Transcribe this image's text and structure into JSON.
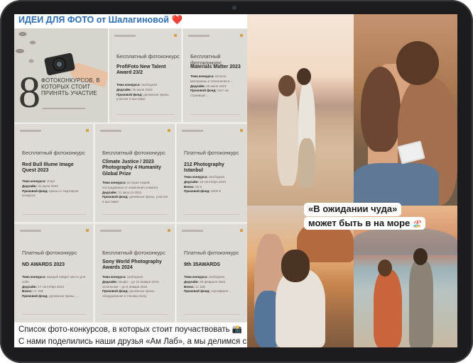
{
  "post_left": {
    "header_title": "ИДЕИ ДЛЯ ФОТО от Шалагиновой",
    "header_emoji": "❤️",
    "intro_card": {
      "number": "8",
      "text": "ФОТОКОНКУРСОВ, В КОТОРЫХ СТОИТ ПРИНЯТЬ УЧАСТИЕ"
    },
    "cards": [
      {
        "kind": "Бесплатный фотоконкурс",
        "name": "ProfiFoto New Talent Award 23/2",
        "rows": [
          [
            "Тема конкурса:",
            "свободная"
          ],
          [
            "Дедлайн:",
            "25 июля 2023"
          ],
          [
            "Призовой фонд:",
            "денежные призы, участие в выставке"
          ]
        ]
      },
      {
        "kind": "Бесплатный фотоконкурс",
        "name": "Materials Matter 2023",
        "rows": [
          [
            "Тема конкурса:",
            "каталог, материалы и технологии в ..."
          ],
          [
            "Дедлайн:",
            "26 июля 2023"
          ],
          [
            "Призовой фонд:",
            "пост на страницах ..."
          ]
        ]
      },
      {
        "kind": "Бесплатный фотоконкурс",
        "name": "Red Bull Illume Image Quest 2023",
        "rows": [
          [
            "Тема конкурса:",
            "спорт"
          ],
          [
            "Дедлайн:",
            "31 июля 2023"
          ],
          [
            "Призовой фонд:",
            "призы от партнёров конкурса"
          ]
        ]
      },
      {
        "kind": "Бесплатный фотоконкурс",
        "name": "Climate Justice / 2023 Photography 4 Humanity Global Prize",
        "rows": [
          [
            "Тема конкурса:",
            "история людей, пострадавших от изменения климата"
          ],
          [
            "Дедлайн:",
            "31 августа 2023"
          ],
          [
            "Призовой фонд:",
            "денежные призы, участие в выставке"
          ]
        ]
      },
      {
        "kind": "Платный фотоконкурс",
        "name": "212 Photography Istanbul",
        "rows": [
          [
            "Тема конкурса:",
            "свободная"
          ],
          [
            "Дедлайн:",
            "10 сентября 2023"
          ],
          [
            "Взнос:",
            "25 €"
          ],
          [
            "Призовой фонд:",
            "5000 €"
          ]
        ]
      },
      {
        "kind": "Платный фотоконкурс",
        "name": "ND AWARDS 2023",
        "rows": [
          [
            "Тема конкурса:",
            "каждый найдет место для себя"
          ],
          [
            "Дедлайн:",
            "17 сентября 2023"
          ],
          [
            "Взнос:",
            "от 15$"
          ],
          [
            "Призовой фонд:",
            "денежные призы, ..."
          ]
        ]
      },
      {
        "kind": "Бесплатный фотоконкурс",
        "name": "Sony World Photography Awards 2024",
        "rows": [
          [
            "Тема конкурса:",
            "свободная"
          ],
          [
            "Дедлайн:",
            "профи – до 12 января 2024, остальные – до 5 января 2024"
          ],
          [
            "Призовой фонд:",
            "денежные призы, оборудование и техника Sony"
          ]
        ]
      },
      {
        "kind": "Платный фотоконкурс",
        "name": "9th 35AWARDS",
        "rows": [
          [
            "Тема конкурса:",
            "свободная"
          ],
          [
            "Дедлайн:",
            "25 февраля 2024"
          ],
          [
            "Взнос:",
            "от 15$"
          ],
          [
            "Призовой фонд:",
            "сертификат ..."
          ]
        ]
      }
    ],
    "caption_line1": "Список фото-конкурсов, в которых стоит поучаствовать 📸",
    "caption_line2": "С нами поделились наши друзья «Ам Лаб», а мы делимся с вами"
  },
  "post_right": {
    "overlay_line1": "«В ожидании чуда»",
    "overlay_line2": "может быть в на море",
    "overlay_sticker": "🏖️"
  }
}
